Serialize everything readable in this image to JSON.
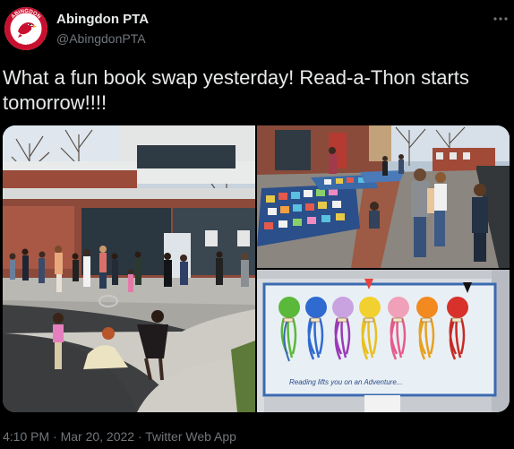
{
  "account": {
    "display_name": "Abingdon PTA",
    "handle": "@AbingdonPTA",
    "avatar_text_top": "ABINGDON",
    "avatar_text_bottom": "ELEMENTARY"
  },
  "more_icon": "more-horizontal-icon",
  "tweet": {
    "text": "What a fun book swap yesterday! Read-a-Thon starts tomorrow!!!!"
  },
  "media": {
    "mural_caption": "Reading lifts you on an Adventure..."
  },
  "meta": {
    "timestamp": "4:10 PM · Mar 20, 2022 · Twitter Web App"
  },
  "colors": {
    "background": "#000000",
    "text": "#e7e9ea",
    "secondary": "#71767b",
    "avatar_red": "#c8102e"
  }
}
